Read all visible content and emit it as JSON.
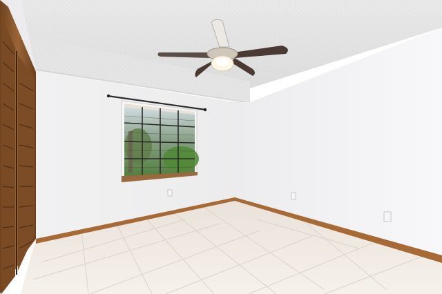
{
  "scene": {
    "description_tag": "empty room",
    "watermark": "",
    "colors": {
      "ceiling": "#eeeeee",
      "wall_left": "#f3f3f4",
      "wall_back": "#ededef",
      "wall_right": "#f5f5f7",
      "floor": "#efe8df",
      "trim": "#a86a35",
      "closet_wood": "#8a5a2f",
      "fan_blade": "#4a3a33"
    },
    "objects": [
      "ceiling-fan",
      "window-with-blinds",
      "curtain-rod",
      "closet-louvered-door",
      "baseboard",
      "tile-floor",
      "outlet"
    ]
  }
}
